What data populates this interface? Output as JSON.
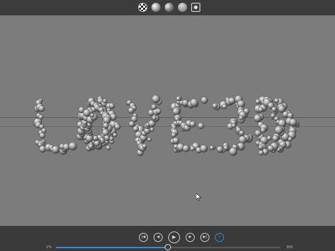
{
  "viewport": {
    "shading_modes": [
      "checker-sphere-icon",
      "matte-sphere-icon",
      "shaded-sphere-icon",
      "gloss-sphere-icon",
      "frame-icon"
    ],
    "scene_text": "LOVE3D"
  },
  "timeline": {
    "start_frame": "1%",
    "end_frame": "300",
    "progress": 0.5,
    "controls": [
      "skip-to-start",
      "step-back",
      "play",
      "step-forward",
      "skip-to-end",
      "loop"
    ]
  },
  "colors": {
    "accent": "#2b8fe0",
    "viewport_bg": "#7c7c7c",
    "bar_bg": "#3a3a3a"
  }
}
